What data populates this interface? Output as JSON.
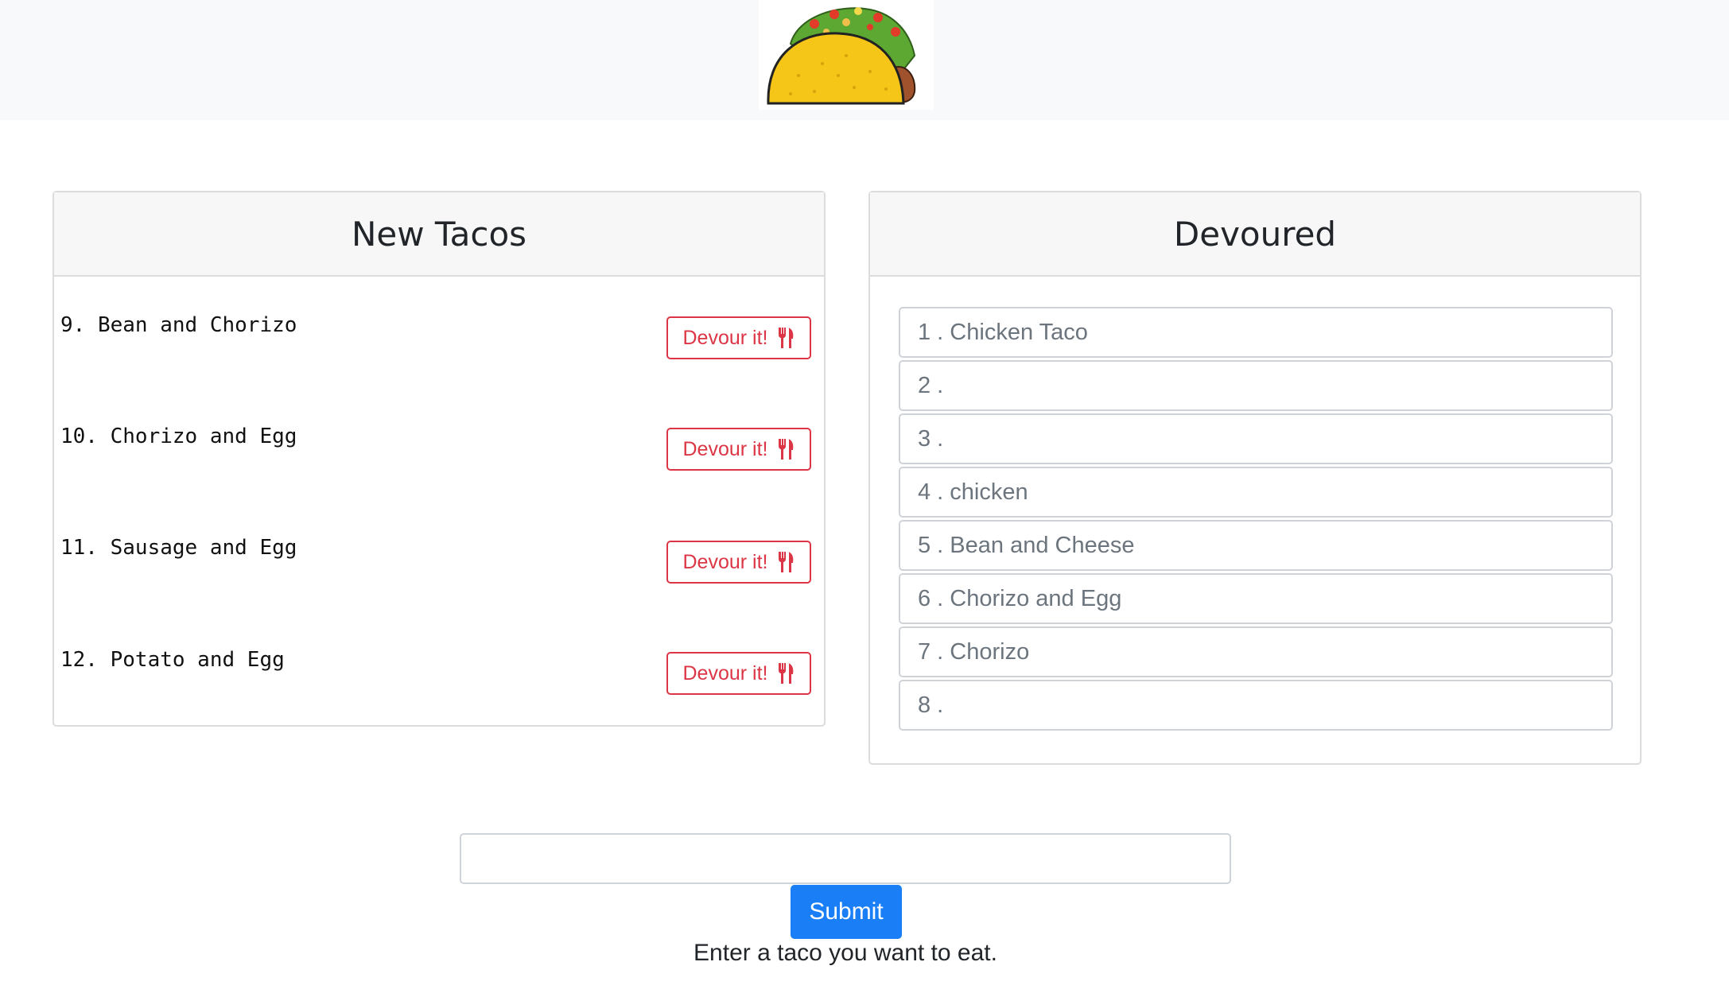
{
  "logo": {
    "icon": "taco-logo"
  },
  "new_tacos": {
    "title": "New Tacos",
    "items": [
      {
        "text": "9. Bean and Chorizo",
        "button": "Devour it!"
      },
      {
        "text": "10. Chorizo and Egg",
        "button": "Devour it!"
      },
      {
        "text": "11. Sausage and Egg",
        "button": "Devour it!"
      },
      {
        "text": "12. Potato and Egg",
        "button": "Devour it!"
      }
    ]
  },
  "devoured": {
    "title": "Devoured",
    "items": [
      {
        "text": "1 . Chicken Taco"
      },
      {
        "text": "2 ."
      },
      {
        "text": "3 ."
      },
      {
        "text": "4 . chicken"
      },
      {
        "text": "5 . Bean and Cheese"
      },
      {
        "text": "6 . Chorizo and Egg"
      },
      {
        "text": "7 . Chorizo"
      },
      {
        "text": "8 ."
      }
    ]
  },
  "form": {
    "input_value": "",
    "input_placeholder": "",
    "submit_label": "Submit",
    "help_text": "Enter a taco you want to eat."
  },
  "colors": {
    "accent": "#1a7ff6",
    "danger": "#dc3545"
  }
}
